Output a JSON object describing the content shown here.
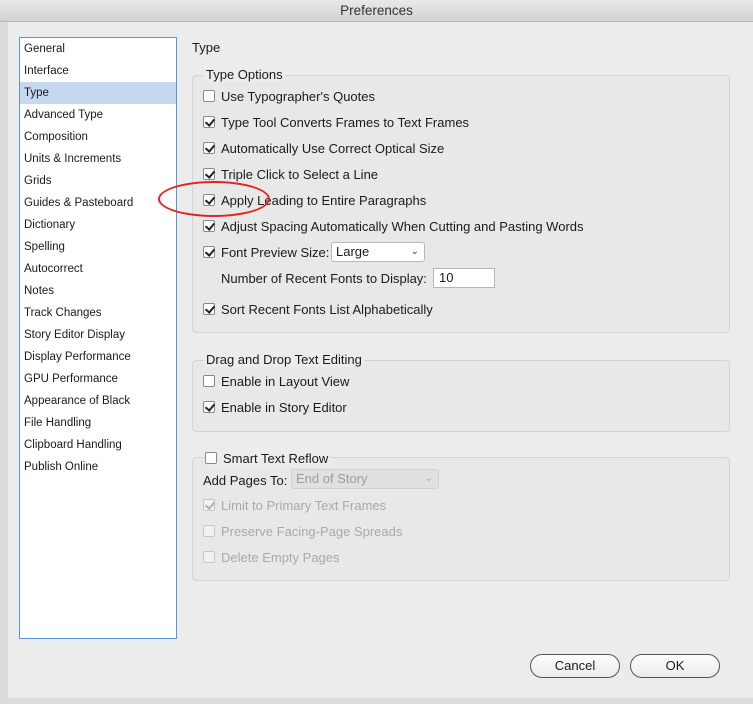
{
  "window": {
    "title": "Preferences"
  },
  "sidebar": {
    "items": [
      {
        "label": "General"
      },
      {
        "label": "Interface"
      },
      {
        "label": "Type",
        "selected": true
      },
      {
        "label": "Advanced Type"
      },
      {
        "label": "Composition"
      },
      {
        "label": "Units & Increments"
      },
      {
        "label": "Grids"
      },
      {
        "label": "Guides & Pasteboard"
      },
      {
        "label": "Dictionary"
      },
      {
        "label": "Spelling"
      },
      {
        "label": "Autocorrect"
      },
      {
        "label": "Notes"
      },
      {
        "label": "Track Changes"
      },
      {
        "label": "Story Editor Display"
      },
      {
        "label": "Display Performance"
      },
      {
        "label": "GPU Performance"
      },
      {
        "label": "Appearance of Black"
      },
      {
        "label": "File Handling"
      },
      {
        "label": "Clipboard Handling"
      },
      {
        "label": "Publish Online"
      }
    ]
  },
  "panel": {
    "title": "Type",
    "type_options": {
      "label": "Type Options",
      "use_typographers_quotes": {
        "label": "Use Typographer's Quotes",
        "checked": false
      },
      "type_tool_converts": {
        "label": "Type Tool Converts Frames to Text Frames",
        "checked": true
      },
      "optical_size": {
        "label": "Automatically Use Correct Optical Size",
        "checked": true
      },
      "triple_click": {
        "label": "Triple Click to Select a Line",
        "checked": true
      },
      "apply_leading": {
        "label": "Apply Leading to Entire Paragraphs",
        "checked": true
      },
      "adjust_spacing": {
        "label": "Adjust Spacing Automatically When Cutting and Pasting Words",
        "checked": true
      },
      "font_preview": {
        "label": "Font Preview Size:",
        "checked": true,
        "value": "Large"
      },
      "recent_fonts": {
        "label": "Number of Recent Fonts to Display:",
        "value": "10"
      },
      "sort_recent": {
        "label": "Sort Recent Fonts List Alphabetically",
        "checked": true
      }
    },
    "drag_drop": {
      "label": "Drag and Drop Text Editing",
      "layout_view": {
        "label": "Enable in Layout View",
        "checked": false
      },
      "story_editor": {
        "label": "Enable in Story Editor",
        "checked": true
      }
    },
    "smart_reflow": {
      "label": "Smart Text Reflow",
      "checked": false,
      "add_pages_label": "Add Pages To:",
      "add_pages_value": "End of Story",
      "limit_primary": {
        "label": "Limit to Primary Text Frames",
        "checked": true
      },
      "preserve_facing": {
        "label": "Preserve Facing-Page Spreads",
        "checked": false
      },
      "delete_empty": {
        "label": "Delete Empty Pages",
        "checked": false
      }
    }
  },
  "buttons": {
    "cancel": "Cancel",
    "ok": "OK"
  },
  "colors": {
    "selection": "#c4d8f0",
    "sidebar_border": "#5b96d6",
    "highlight": "#e02323"
  }
}
